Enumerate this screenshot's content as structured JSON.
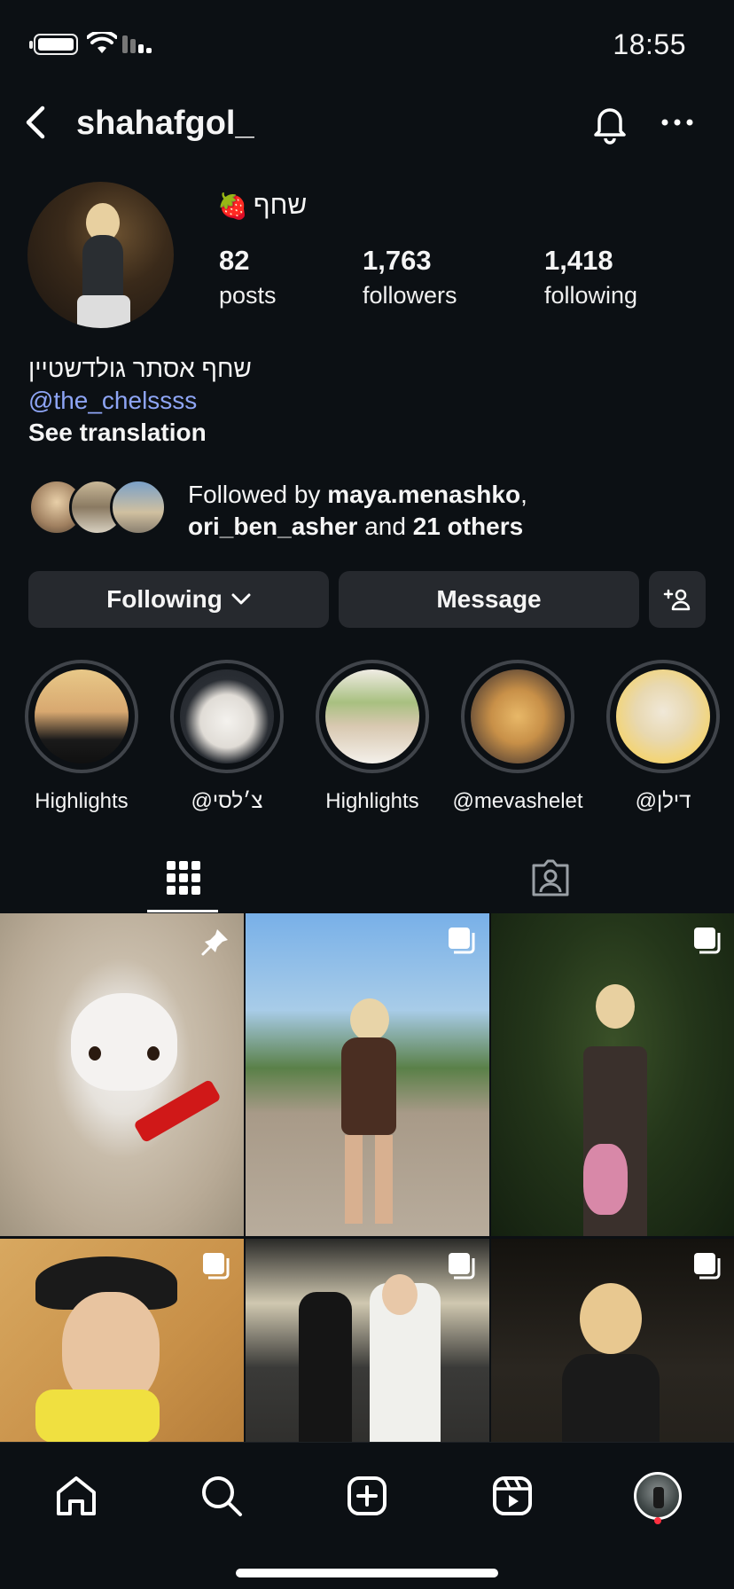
{
  "status_bar": {
    "time": "18:55"
  },
  "header": {
    "username": "shahafgol_"
  },
  "profile": {
    "display_name": "שחף",
    "display_emoji": "🍓",
    "stats": [
      {
        "value": "82",
        "label": "posts"
      },
      {
        "value": "1,763",
        "label": "followers"
      },
      {
        "value": "1,418",
        "label": "following"
      }
    ],
    "bio_line": "שחף אסתר גולדשטיין",
    "bio_mention": "@the_chelssss",
    "see_translation": "See translation"
  },
  "followed_by": {
    "prefix": "Followed by ",
    "user1": "maya.menashko",
    "sep": ",",
    "user2": "ori_ben_asher",
    "and": " and ",
    "others": "21 others"
  },
  "buttons": {
    "following": "Following",
    "message": "Message"
  },
  "highlights": [
    {
      "label": "Highlights"
    },
    {
      "label": "@צ׳לסי"
    },
    {
      "label": "Highlights"
    },
    {
      "label": "@mevashelet"
    },
    {
      "label": "@דילן"
    }
  ],
  "icons": {
    "back": "chevron-left-icon",
    "bell": "bell-icon",
    "more": "more-icon",
    "grid": "grid-icon",
    "tagged": "tagged-icon",
    "pin": "pin-icon",
    "multi": "multi-post-icon",
    "home": "home-icon",
    "search": "search-icon",
    "create": "create-icon",
    "reels": "reels-icon"
  },
  "colors": {
    "background": "#0c1014",
    "button": "#26292e",
    "mention": "#8ea5f5",
    "notification": "#ff3040"
  }
}
